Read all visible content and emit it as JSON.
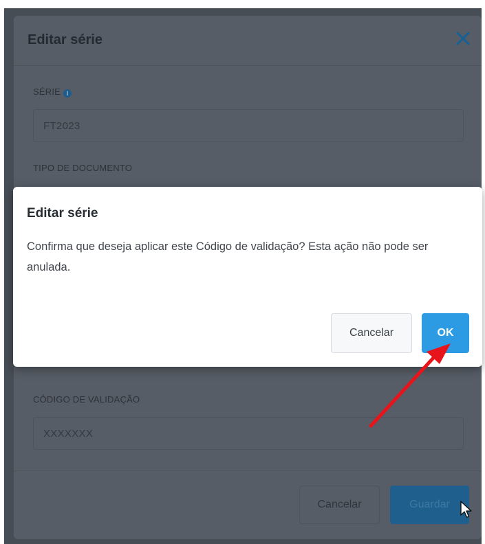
{
  "background_modal": {
    "title": "Editar série",
    "serie_label": "SÉRIE",
    "serie_value": "FT2023",
    "tipo_documento_label": "TIPO DE DOCUMENTO",
    "codigo_validacao_label": "CÓDIGO DE VALIDAÇÃO",
    "codigo_validacao_value": "XXXXXXX",
    "cancel_label": "Cancelar",
    "save_label": "Guardar"
  },
  "confirm_dialog": {
    "title": "Editar série",
    "message": "Confirma que deseja aplicar este Código de validação? Esta ação não pode ser anulada.",
    "cancel_label": "Cancelar",
    "ok_label": "OK"
  },
  "colors": {
    "ok_button": "#2c9be3",
    "annotation_arrow": "#e8141b",
    "overlay": "#474d55"
  },
  "icons": {
    "close": "close-icon",
    "info": "info-icon",
    "cursor": "mouse-pointer-icon",
    "annotation": "red-arrow-annotation"
  }
}
